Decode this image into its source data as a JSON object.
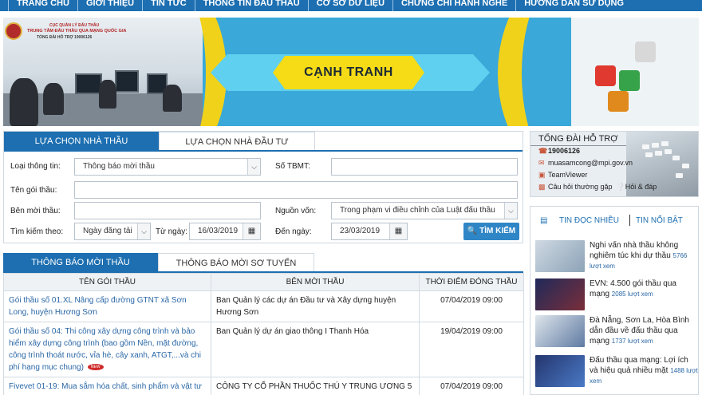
{
  "nav": {
    "items": [
      "TRANG CHỦ",
      "GIỚI THIỆU",
      "TIN TỨC",
      "THÔNG TIN ĐẤU THẦU",
      "CƠ SỞ DỮ LIỆU",
      "CHỨNG CHỈ HÀNH NGHỀ",
      "HƯỚNG DẪN SỬ DỤNG"
    ]
  },
  "banner": {
    "logo_lines": [
      "CỤC QUẢN LÝ ĐẤU THẦU",
      "TRUNG TÂM ĐẤU THẦU QUA MẠNG QUỐC GIA",
      "TỔNG ĐÀI HỖ TRỢ 19006126"
    ],
    "headline": "CẠNH TRANH"
  },
  "search": {
    "tabs": [
      "LỰA CHỌN NHÀ THẦU",
      "LỰA CHỌN NHÀ ĐẦU TƯ"
    ],
    "info_type_label": "Loại thông tin:",
    "info_type_value": "Thông báo mời thầu",
    "tbmt_label": "Số TBMT:",
    "tbmt_value": "",
    "package_label": "Tên gói thầu:",
    "package_value": "",
    "inviter_label": "Bên mời thầu:",
    "inviter_value": "",
    "funding_label": "Nguồn vốn:",
    "funding_value": "Trong phạm vi điều chỉnh của Luật đấu thầu",
    "search_by_label": "Tìm kiếm theo:",
    "search_by_value": "Ngày đăng tải",
    "from_label": "Từ ngày:",
    "from_value": "16/03/2019",
    "to_label": "Đến ngày:",
    "to_value": "23/03/2019",
    "search_button": "TÌM KIẾM"
  },
  "results": {
    "tabs": [
      "THÔNG BÁO MỜI THẦU",
      "THÔNG BÁO MỜI SƠ TUYỂN"
    ],
    "columns": [
      "TÊN GÓI THẦU",
      "BÊN MỜI THẦU",
      "THỜI ĐIỂM ĐÓNG THẦU"
    ],
    "badge": "NEW",
    "rows": [
      {
        "title": "Gói thầu số 01.XL Nâng cấp đường GTNT xã Sơn Long, huyện Hương Sơn",
        "inviter": "Ban Quản lý các dự án Đầu tư và Xây dựng huyện Hương Sơn",
        "close": "07/04/2019 09:00"
      },
      {
        "title": "Gói thầu số 04: Thi công xây dựng công trình và bảo hiểm xây dựng công trình (bao gồm Nền, mặt đường, công trình thoát nước, vỉa hè, cây xanh, ATGT,...và chi phí hạng mục chung)",
        "inviter": "Ban Quản lý dự án giao thông I Thanh Hóa",
        "close": "19/04/2019 09:00"
      },
      {
        "title": "Fivevet 01-19: Mua sắm hóa chất, sinh phẩm và vật tư",
        "inviter": "CÔNG TY CỔ PHẦN THUỐC THÚ Y TRUNG ƯƠNG 5",
        "close": "07/04/2019 09:00"
      }
    ]
  },
  "support": {
    "title": "TỔNG ĐÀI HỖ TRỢ",
    "phone": "19006126",
    "email": "muasamcong@mpi.gov.vn",
    "teamviewer": "TeamViewer",
    "faq": "Câu hỏi thường gặp",
    "qa": "Hỏi & đáp"
  },
  "news": {
    "tab_most_read": "TIN ĐỌC NHIỀU",
    "tab_featured": "TIN NỔI BẬT",
    "items": [
      {
        "title": "Nghi vấn nhà thầu không nghiêm túc khi dự thầu",
        "views": "5766 lượt xem"
      },
      {
        "title": "EVN: 4.500 gói thầu qua mạng",
        "views": "2085 lượt xem"
      },
      {
        "title": "Đà Nẵng, Sơn La, Hòa Bình dẫn đầu về đấu thầu qua mạng",
        "views": "1737 lượt xem"
      },
      {
        "title": "Đấu thầu qua mạng: Lợi ích và hiệu quả nhiều mặt",
        "views": "1488 lượt xem"
      }
    ]
  },
  "colors": {
    "primary": "#1d6fb1",
    "banner_blue": "#3aa8d8",
    "banner_yellow": "#f5dc16",
    "link": "#2a67a6"
  }
}
